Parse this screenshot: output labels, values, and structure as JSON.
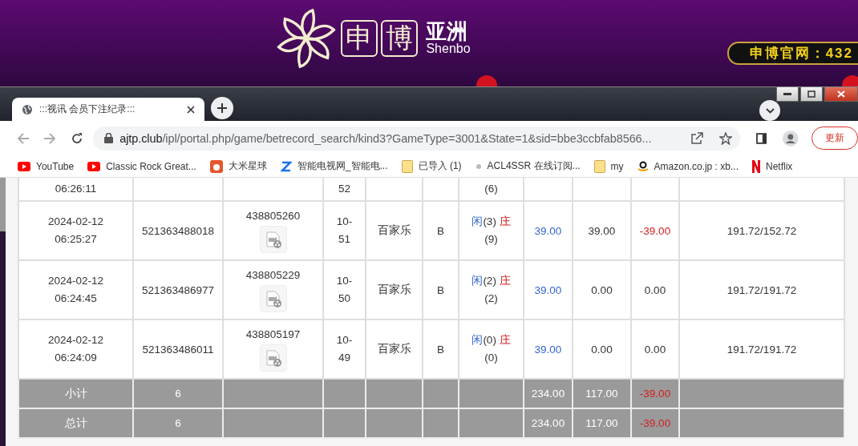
{
  "site_header": {
    "logo_chars": [
      "申",
      "博"
    ],
    "logo_text": "亚洲",
    "logo_subtext": "Shenbo",
    "marquee": "申博官网：432"
  },
  "browser": {
    "tab_title": ":::视讯 会员下注纪录:::",
    "url_host": "ajtp.club",
    "url_path": "/ipl/portal.php/game/betrecord_search/kind3?GameType=3001&State=1&sid=bbe3ccbfab8566...",
    "update_button": "更新",
    "bookmarks": [
      {
        "label": "YouTube",
        "kind": "youtube"
      },
      {
        "label": "Classic Rock Great...",
        "kind": "youtube"
      },
      {
        "label": "大米星球",
        "kind": "app"
      },
      {
        "label": "智能电视网_智能电...",
        "kind": "z"
      },
      {
        "label": "已导入 (1)",
        "kind": "folder"
      },
      {
        "label": "ACL4SSR 在线订阅...",
        "kind": "dot"
      },
      {
        "label": "my",
        "kind": "folder"
      },
      {
        "label": "Amazon.co.jp : xb...",
        "kind": "amazon"
      },
      {
        "label": "Netflix",
        "kind": "netflix"
      }
    ]
  },
  "table": {
    "rows": [
      {
        "time": "06:26:11",
        "round": [
          "52"
        ],
        "result": {
          "banker_score": "(6)"
        }
      },
      {
        "date": "2024-02-12",
        "time": "06:25:27",
        "bet_no": "521363488018",
        "game_no": "438805260",
        "round": [
          "10-",
          "51"
        ],
        "game": "百家乐",
        "table": "B",
        "result": {
          "player_label": "闲",
          "player_score": "(3)",
          "banker_label": "庄",
          "banker_score": "(9)"
        },
        "bet": "39.00",
        "valid": "39.00",
        "win": "-39.00",
        "win_negative": true,
        "balance": "191.72/152.72"
      },
      {
        "date": "2024-02-12",
        "time": "06:24:45",
        "bet_no": "521363486977",
        "game_no": "438805229",
        "round": [
          "10-",
          "50"
        ],
        "game": "百家乐",
        "table": "B",
        "result": {
          "player_label": "闲",
          "player_score": "(2)",
          "banker_label": "庄",
          "banker_score": "(2)"
        },
        "bet": "39.00",
        "valid": "0.00",
        "win": "0.00",
        "win_negative": false,
        "balance": "191.72/191.72"
      },
      {
        "date": "2024-02-12",
        "time": "06:24:09",
        "bet_no": "521363486011",
        "game_no": "438805197",
        "round": [
          "10-",
          "49"
        ],
        "game": "百家乐",
        "table": "B",
        "result": {
          "player_label": "闲",
          "player_score": "(0)",
          "banker_label": "庄",
          "banker_score": "(0)"
        },
        "bet": "39.00",
        "valid": "0.00",
        "win": "0.00",
        "win_negative": false,
        "balance": "191.72/191.72"
      }
    ],
    "totals": [
      {
        "label": "小计",
        "count": "6",
        "bet": "234.00",
        "valid": "117.00",
        "win": "-39.00",
        "win_negative": true
      },
      {
        "label": "总计",
        "count": "6",
        "bet": "234.00",
        "valid": "117.00",
        "win": "-39.00",
        "win_negative": true
      }
    ]
  }
}
